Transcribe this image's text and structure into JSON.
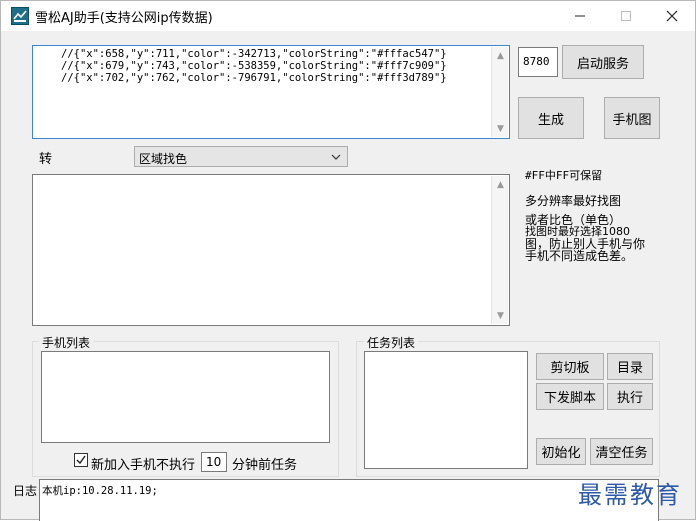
{
  "window": {
    "title": "雪松AJ助手(支持公网ip传数据)"
  },
  "top": {
    "code_lines": [
      "//{\"x\":658,\"y\":711,\"color\":-342713,\"colorString\":\"#fffac547\"}",
      "//{\"x\":679,\"y\":743,\"color\":-538359,\"colorString\":\"#fff7c909\"}",
      "//{\"x\":702,\"y\":762,\"color\":-796791,\"colorString\":\"#fff3d789\"}"
    ],
    "port_value": "8780",
    "start_service_label": "启动服务",
    "generate_label": "生成",
    "phone_image_label": "手机图"
  },
  "convert": {
    "label": "转",
    "mode_selected": "区域找色"
  },
  "hints": {
    "line1": "#FF中FF可保留",
    "line2": "多分辨率最好找图",
    "line3": "或者比色（单色）",
    "line4": "找图时最好选择1080",
    "line5": "图，防止别人手机与你",
    "line6": "手机不同造成色差。"
  },
  "phone_list": {
    "title": "手机列表",
    "checkbox_label": "新加入手机不执行",
    "checkbox_checked": true,
    "minutes_value": "10",
    "minutes_suffix": "分钟前任务"
  },
  "task_list": {
    "title": "任务列表",
    "clipboard_label": "剪切板",
    "directory_label": "目录",
    "dispatch_label": "下发脚本",
    "execute_label": "执行",
    "init_label": "初始化",
    "clear_label": "清空任务"
  },
  "log": {
    "label": "日志",
    "text": "本机ip:10.28.11.19;"
  },
  "watermark": {
    "text": "最需教育"
  }
}
